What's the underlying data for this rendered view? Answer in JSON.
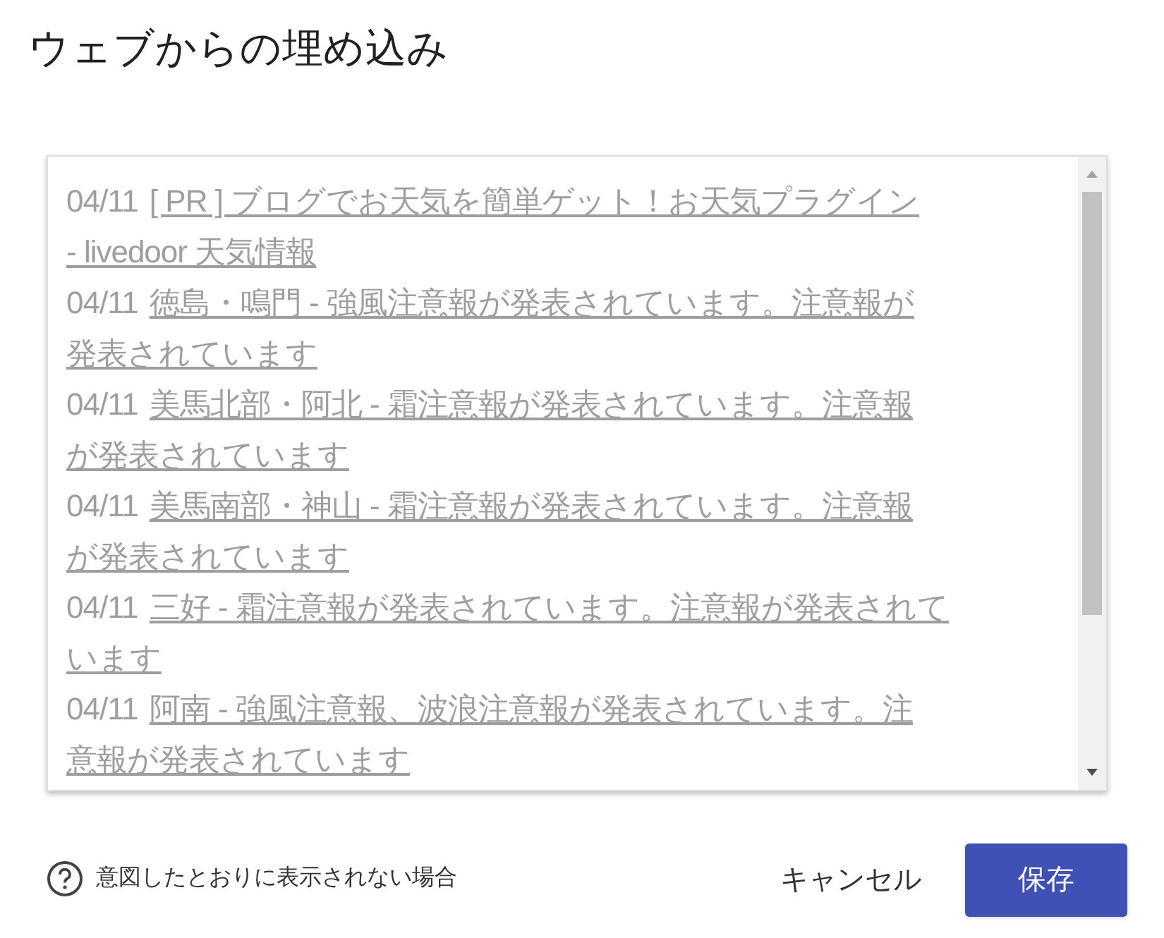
{
  "title": "ウェブからの埋め込み",
  "feed_items": [
    {
      "date": "04/11",
      "link_lines": [
        "[ PR ] ブログでお天気を簡単ゲット！お天気プラグイン",
        "- livedoor 天気情報"
      ]
    },
    {
      "date": "04/11",
      "link_lines": [
        "徳島・鳴門 - 強風注意報が発表されています。注意報が",
        "発表されています"
      ]
    },
    {
      "date": "04/11",
      "link_lines": [
        "美馬北部・阿北 - 霜注意報が発表されています。注意報",
        "が発表されています"
      ]
    },
    {
      "date": "04/11",
      "link_lines": [
        "美馬南部・神山 - 霜注意報が発表されています。注意報",
        "が発表されています"
      ]
    },
    {
      "date": "04/11",
      "link_lines": [
        "三好 - 霜注意報が発表されています。注意報が発表されて",
        "います"
      ]
    },
    {
      "date": "04/11",
      "link_lines": [
        "阿南 - 強風注意報、波浪注意報が発表されています。注",
        "意報が発表されています"
      ]
    }
  ],
  "help_link": "意図したとおりに表示されない場合",
  "cancel_button": "キャンセル",
  "save_button": "保存"
}
